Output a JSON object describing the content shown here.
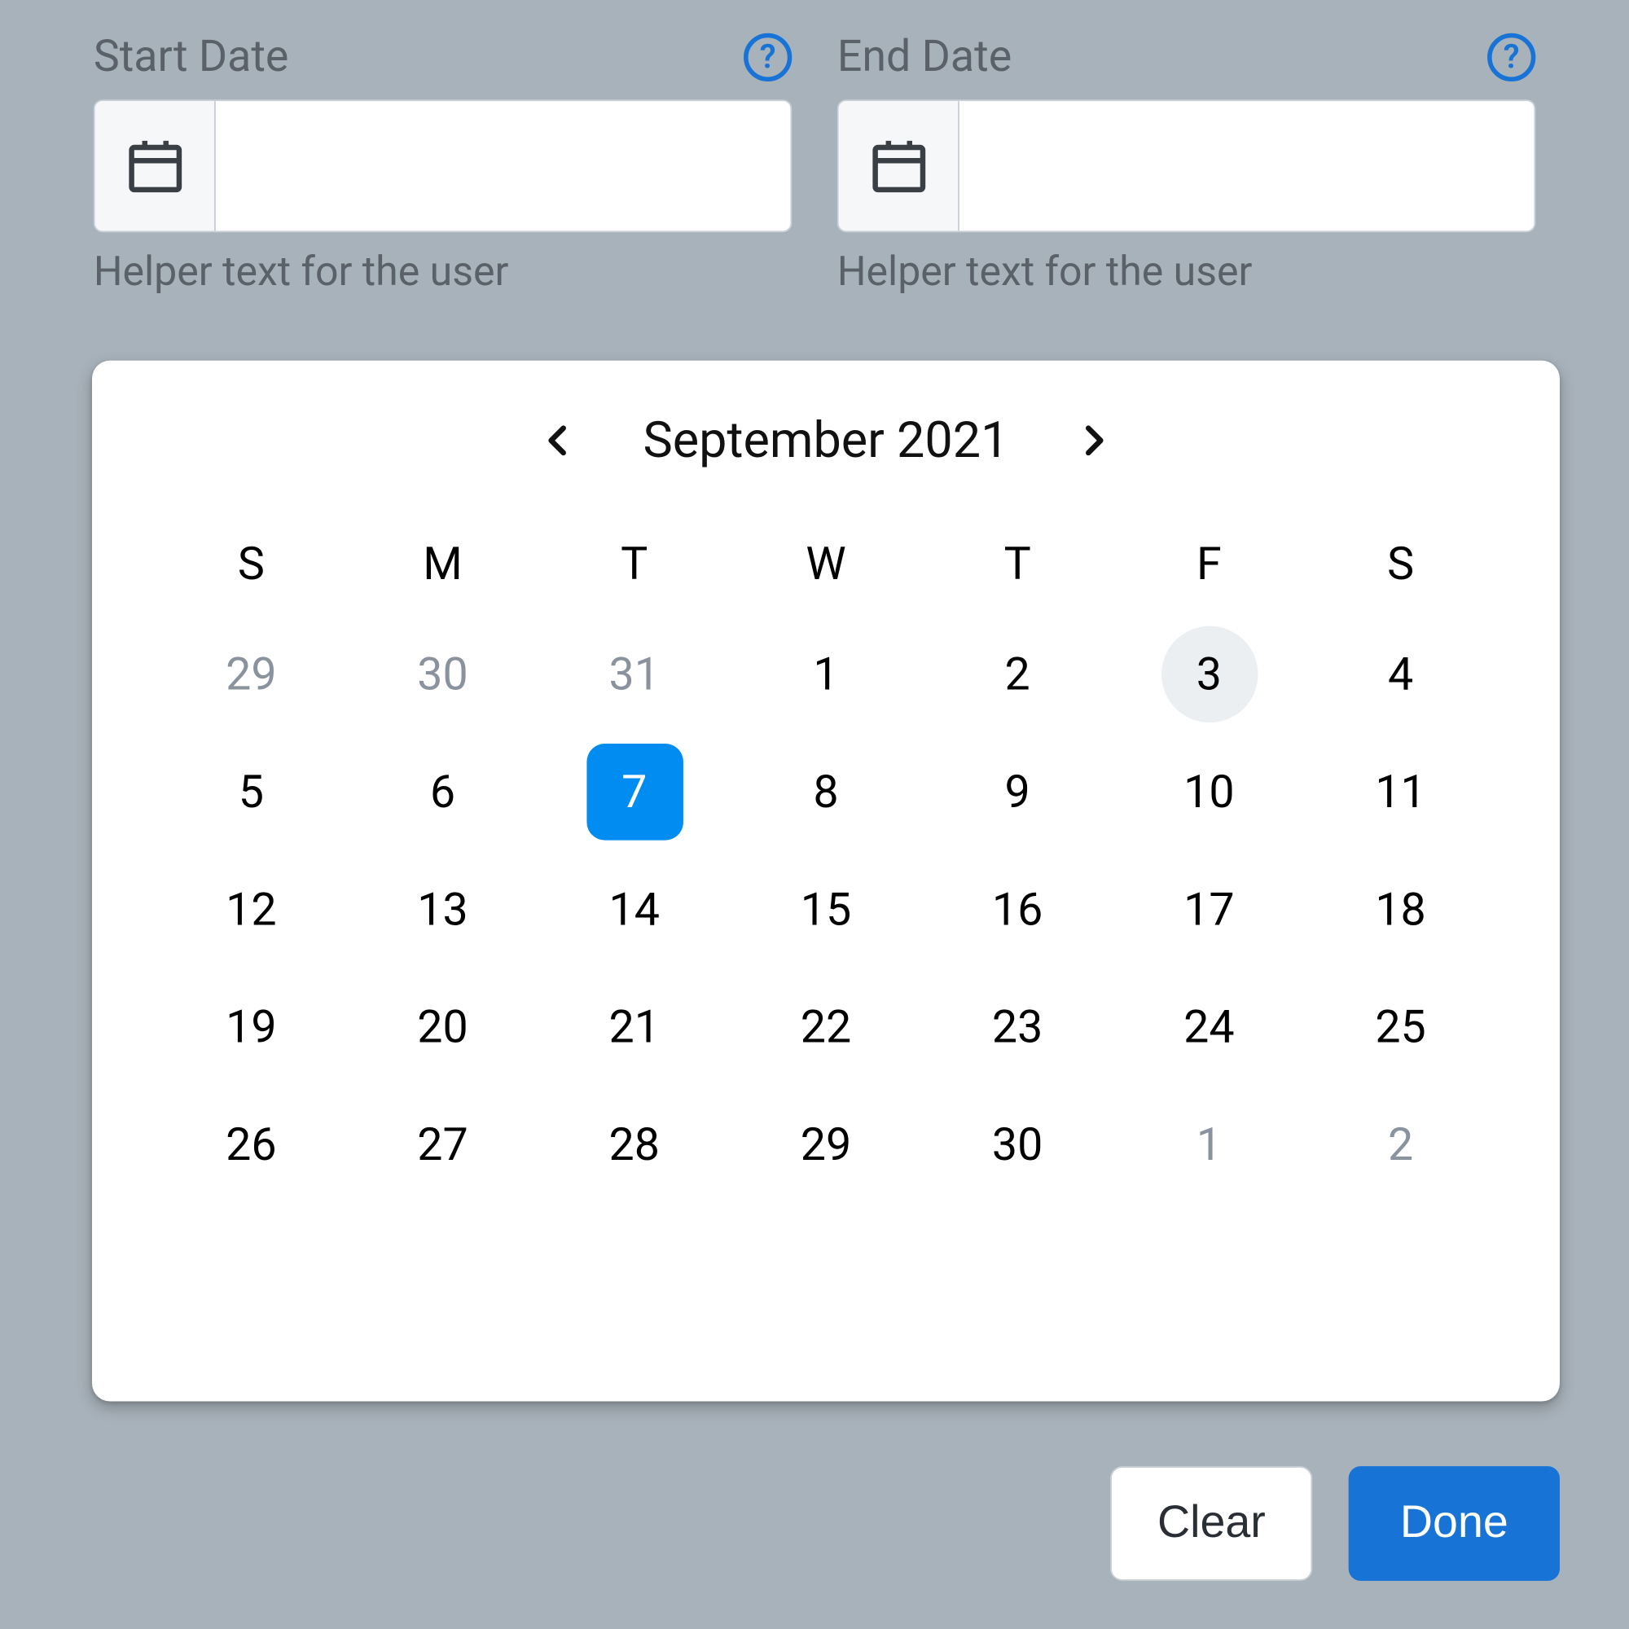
{
  "fields": {
    "start": {
      "label": "Start Date",
      "value": "",
      "helper": "Helper text for the user",
      "help_glyph": "?"
    },
    "end": {
      "label": "End Date",
      "value": "",
      "helper": "Helper text for the user",
      "help_glyph": "?"
    }
  },
  "calendar": {
    "month_label": "September 2021",
    "weekdays": [
      "S",
      "M",
      "T",
      "W",
      "T",
      "F",
      "S"
    ],
    "days": [
      {
        "n": "29",
        "other": true
      },
      {
        "n": "30",
        "other": true
      },
      {
        "n": "31",
        "other": true
      },
      {
        "n": "1"
      },
      {
        "n": "2"
      },
      {
        "n": "3",
        "today": true
      },
      {
        "n": "4"
      },
      {
        "n": "5"
      },
      {
        "n": "6"
      },
      {
        "n": "7",
        "selected": true
      },
      {
        "n": "8"
      },
      {
        "n": "9"
      },
      {
        "n": "10"
      },
      {
        "n": "11"
      },
      {
        "n": "12"
      },
      {
        "n": "13"
      },
      {
        "n": "14"
      },
      {
        "n": "15"
      },
      {
        "n": "16"
      },
      {
        "n": "17"
      },
      {
        "n": "18"
      },
      {
        "n": "19"
      },
      {
        "n": "20"
      },
      {
        "n": "21"
      },
      {
        "n": "22"
      },
      {
        "n": "23"
      },
      {
        "n": "24"
      },
      {
        "n": "25"
      },
      {
        "n": "26"
      },
      {
        "n": "27"
      },
      {
        "n": "28"
      },
      {
        "n": "29"
      },
      {
        "n": "30"
      },
      {
        "n": "1",
        "other": true
      },
      {
        "n": "2",
        "other": true
      }
    ]
  },
  "buttons": {
    "clear": "Clear",
    "done": "Done"
  },
  "colors": {
    "accent": "#1773d6",
    "selected": "#008cf0",
    "muted_text": "#5a6169",
    "bg": "#a8b2ba"
  }
}
